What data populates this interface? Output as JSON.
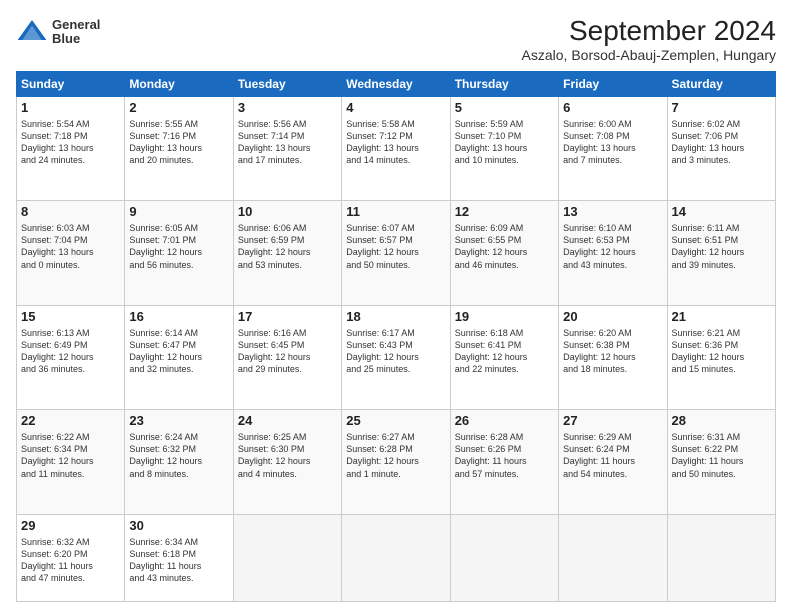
{
  "logo": {
    "line1": "General",
    "line2": "Blue"
  },
  "title": "September 2024",
  "subtitle": "Aszalo, Borsod-Abauj-Zemplen, Hungary",
  "weekdays": [
    "Sunday",
    "Monday",
    "Tuesday",
    "Wednesday",
    "Thursday",
    "Friday",
    "Saturday"
  ],
  "weeks": [
    [
      {
        "day": "1",
        "info": "Sunrise: 5:54 AM\nSunset: 7:18 PM\nDaylight: 13 hours\nand 24 minutes."
      },
      {
        "day": "2",
        "info": "Sunrise: 5:55 AM\nSunset: 7:16 PM\nDaylight: 13 hours\nand 20 minutes."
      },
      {
        "day": "3",
        "info": "Sunrise: 5:56 AM\nSunset: 7:14 PM\nDaylight: 13 hours\nand 17 minutes."
      },
      {
        "day": "4",
        "info": "Sunrise: 5:58 AM\nSunset: 7:12 PM\nDaylight: 13 hours\nand 14 minutes."
      },
      {
        "day": "5",
        "info": "Sunrise: 5:59 AM\nSunset: 7:10 PM\nDaylight: 13 hours\nand 10 minutes."
      },
      {
        "day": "6",
        "info": "Sunrise: 6:00 AM\nSunset: 7:08 PM\nDaylight: 13 hours\nand 7 minutes."
      },
      {
        "day": "7",
        "info": "Sunrise: 6:02 AM\nSunset: 7:06 PM\nDaylight: 13 hours\nand 3 minutes."
      }
    ],
    [
      {
        "day": "8",
        "info": "Sunrise: 6:03 AM\nSunset: 7:04 PM\nDaylight: 13 hours\nand 0 minutes."
      },
      {
        "day": "9",
        "info": "Sunrise: 6:05 AM\nSunset: 7:01 PM\nDaylight: 12 hours\nand 56 minutes."
      },
      {
        "day": "10",
        "info": "Sunrise: 6:06 AM\nSunset: 6:59 PM\nDaylight: 12 hours\nand 53 minutes."
      },
      {
        "day": "11",
        "info": "Sunrise: 6:07 AM\nSunset: 6:57 PM\nDaylight: 12 hours\nand 50 minutes."
      },
      {
        "day": "12",
        "info": "Sunrise: 6:09 AM\nSunset: 6:55 PM\nDaylight: 12 hours\nand 46 minutes."
      },
      {
        "day": "13",
        "info": "Sunrise: 6:10 AM\nSunset: 6:53 PM\nDaylight: 12 hours\nand 43 minutes."
      },
      {
        "day": "14",
        "info": "Sunrise: 6:11 AM\nSunset: 6:51 PM\nDaylight: 12 hours\nand 39 minutes."
      }
    ],
    [
      {
        "day": "15",
        "info": "Sunrise: 6:13 AM\nSunset: 6:49 PM\nDaylight: 12 hours\nand 36 minutes."
      },
      {
        "day": "16",
        "info": "Sunrise: 6:14 AM\nSunset: 6:47 PM\nDaylight: 12 hours\nand 32 minutes."
      },
      {
        "day": "17",
        "info": "Sunrise: 6:16 AM\nSunset: 6:45 PM\nDaylight: 12 hours\nand 29 minutes."
      },
      {
        "day": "18",
        "info": "Sunrise: 6:17 AM\nSunset: 6:43 PM\nDaylight: 12 hours\nand 25 minutes."
      },
      {
        "day": "19",
        "info": "Sunrise: 6:18 AM\nSunset: 6:41 PM\nDaylight: 12 hours\nand 22 minutes."
      },
      {
        "day": "20",
        "info": "Sunrise: 6:20 AM\nSunset: 6:38 PM\nDaylight: 12 hours\nand 18 minutes."
      },
      {
        "day": "21",
        "info": "Sunrise: 6:21 AM\nSunset: 6:36 PM\nDaylight: 12 hours\nand 15 minutes."
      }
    ],
    [
      {
        "day": "22",
        "info": "Sunrise: 6:22 AM\nSunset: 6:34 PM\nDaylight: 12 hours\nand 11 minutes."
      },
      {
        "day": "23",
        "info": "Sunrise: 6:24 AM\nSunset: 6:32 PM\nDaylight: 12 hours\nand 8 minutes."
      },
      {
        "day": "24",
        "info": "Sunrise: 6:25 AM\nSunset: 6:30 PM\nDaylight: 12 hours\nand 4 minutes."
      },
      {
        "day": "25",
        "info": "Sunrise: 6:27 AM\nSunset: 6:28 PM\nDaylight: 12 hours\nand 1 minute."
      },
      {
        "day": "26",
        "info": "Sunrise: 6:28 AM\nSunset: 6:26 PM\nDaylight: 11 hours\nand 57 minutes."
      },
      {
        "day": "27",
        "info": "Sunrise: 6:29 AM\nSunset: 6:24 PM\nDaylight: 11 hours\nand 54 minutes."
      },
      {
        "day": "28",
        "info": "Sunrise: 6:31 AM\nSunset: 6:22 PM\nDaylight: 11 hours\nand 50 minutes."
      }
    ],
    [
      {
        "day": "29",
        "info": "Sunrise: 6:32 AM\nSunset: 6:20 PM\nDaylight: 11 hours\nand 47 minutes."
      },
      {
        "day": "30",
        "info": "Sunrise: 6:34 AM\nSunset: 6:18 PM\nDaylight: 11 hours\nand 43 minutes."
      },
      {
        "day": "",
        "info": ""
      },
      {
        "day": "",
        "info": ""
      },
      {
        "day": "",
        "info": ""
      },
      {
        "day": "",
        "info": ""
      },
      {
        "day": "",
        "info": ""
      }
    ]
  ]
}
